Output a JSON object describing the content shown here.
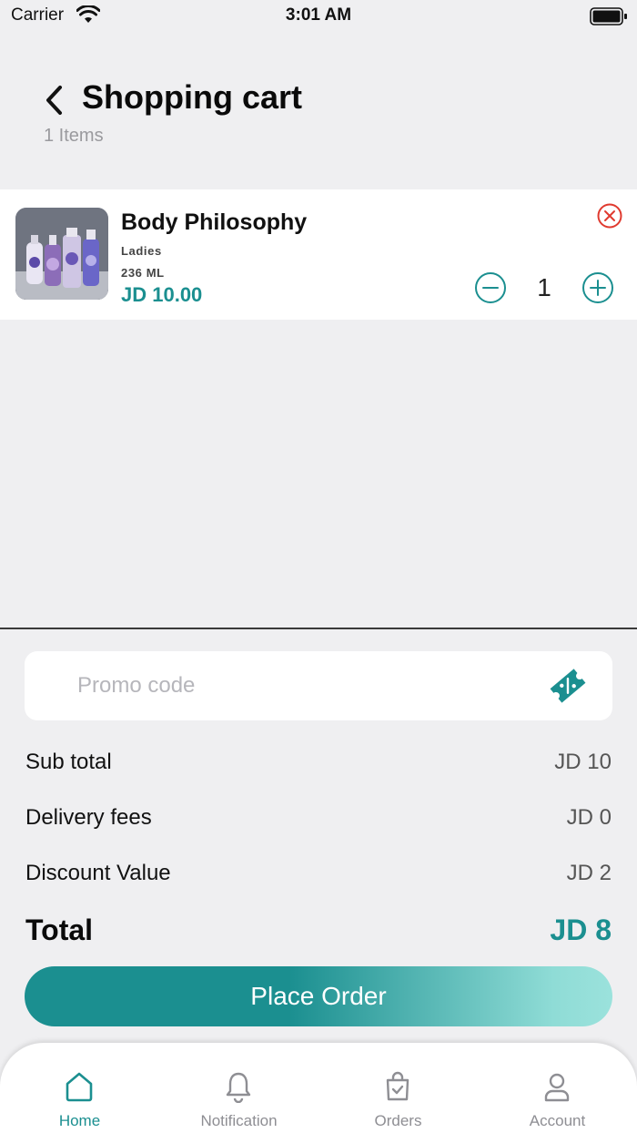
{
  "status_bar": {
    "carrier": "Carrier",
    "time": "3:01 AM"
  },
  "header": {
    "title": "Shopping cart",
    "items_count": "1 Items"
  },
  "cart": {
    "items": [
      {
        "name": "Body Philosophy",
        "category": "Ladies",
        "size": "236 ML",
        "price": "JD 10.00",
        "quantity": "1"
      }
    ]
  },
  "promo": {
    "placeholder": "Promo code",
    "value": ""
  },
  "summary": {
    "subtotal_label": "Sub total",
    "subtotal_value": "JD 10",
    "delivery_label": "Delivery fees",
    "delivery_value": "JD 0",
    "discount_label": "Discount Value",
    "discount_value": "JD 2",
    "total_label": "Total",
    "total_value": "JD 8"
  },
  "actions": {
    "place_order": "Place Order"
  },
  "tab_bar": {
    "tabs": [
      {
        "label": "Home",
        "icon": "home-icon",
        "active": true
      },
      {
        "label": "Notification",
        "icon": "bell-icon",
        "active": false
      },
      {
        "label": "Orders",
        "icon": "shopping-bag-icon",
        "active": false
      },
      {
        "label": "Account",
        "icon": "user-icon",
        "active": false
      }
    ]
  },
  "colors": {
    "accent": "#1b8f90",
    "remove": "#e03a2f",
    "background": "#efeff1",
    "muted_text": "#9a9a9e"
  }
}
